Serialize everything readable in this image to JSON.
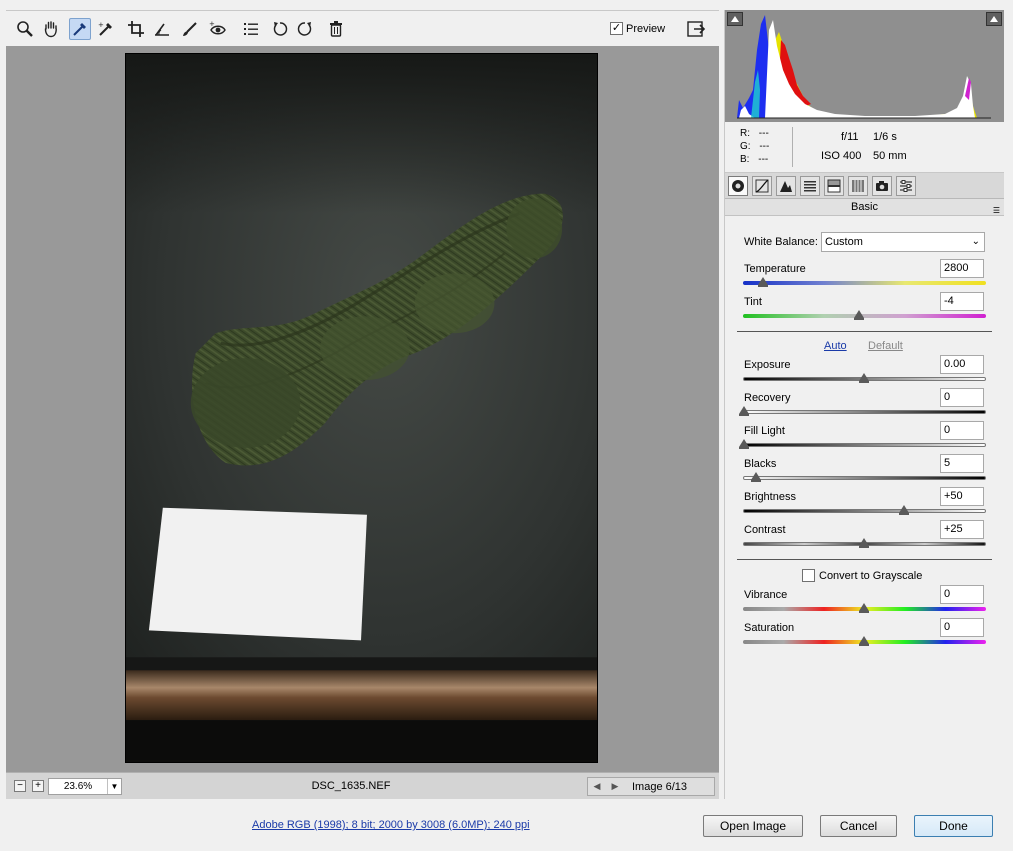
{
  "toolbar": {
    "tools": [
      {
        "name": "zoom-tool",
        "icon": "magnifier-icon"
      },
      {
        "name": "hand-tool",
        "icon": "hand-icon"
      },
      {
        "name": "white-balance-tool",
        "icon": "eyedropper-icon",
        "active": true
      },
      {
        "name": "color-sampler-tool",
        "icon": "sampler-icon"
      },
      {
        "name": "crop-tool",
        "icon": "crop-icon"
      },
      {
        "name": "straighten-tool",
        "icon": "straighten-icon"
      },
      {
        "name": "retouch-tool",
        "icon": "brush-icon"
      },
      {
        "name": "red-eye-tool",
        "icon": "eye-icon"
      },
      {
        "name": "preferences-tool",
        "icon": "list-icon"
      },
      {
        "name": "rotate-left-tool",
        "icon": "rotate-left-icon"
      },
      {
        "name": "rotate-right-tool",
        "icon": "rotate-right-icon"
      },
      {
        "name": "delete-tool",
        "icon": "trash-icon"
      }
    ],
    "preview_label": "Preview",
    "preview_checked": true
  },
  "status": {
    "zoom": "23.6%",
    "filename": "DSC_1635.NEF",
    "image_count": "Image 6/13"
  },
  "info": {
    "r_label": "R:",
    "r_val": "---",
    "g_label": "G:",
    "g_val": "---",
    "b_label": "B:",
    "b_val": "---",
    "aperture": "f/11",
    "shutter": "1/6 s",
    "iso": "ISO 400",
    "focal": "50 mm"
  },
  "panel": {
    "title": "Basic",
    "white_balance_label": "White Balance:",
    "white_balance_value": "Custom",
    "auto_label": "Auto",
    "default_label": "Default",
    "convert_label": "Convert to Grayscale",
    "convert_checked": false,
    "sliders": {
      "temperature": {
        "label": "Temperature",
        "value": "2800"
      },
      "tint": {
        "label": "Tint",
        "value": "-4"
      },
      "exposure": {
        "label": "Exposure",
        "value": "0.00"
      },
      "recovery": {
        "label": "Recovery",
        "value": "0"
      },
      "fill_light": {
        "label": "Fill Light",
        "value": "0"
      },
      "blacks": {
        "label": "Blacks",
        "value": "5"
      },
      "brightness": {
        "label": "Brightness",
        "value": "+50"
      },
      "contrast": {
        "label": "Contrast",
        "value": "+25"
      },
      "vibrance": {
        "label": "Vibrance",
        "value": "0"
      },
      "saturation": {
        "label": "Saturation",
        "value": "0"
      }
    }
  },
  "footer": {
    "workflow_link": "Adobe RGB (1998); 8 bit; 2000 by 3008 (6.0MP); 240 ppi",
    "open_image": "Open Image",
    "cancel": "Cancel",
    "done": "Done"
  },
  "colors": {
    "accent": "#1a3aa8",
    "active_tool": "#c5d9f4"
  }
}
